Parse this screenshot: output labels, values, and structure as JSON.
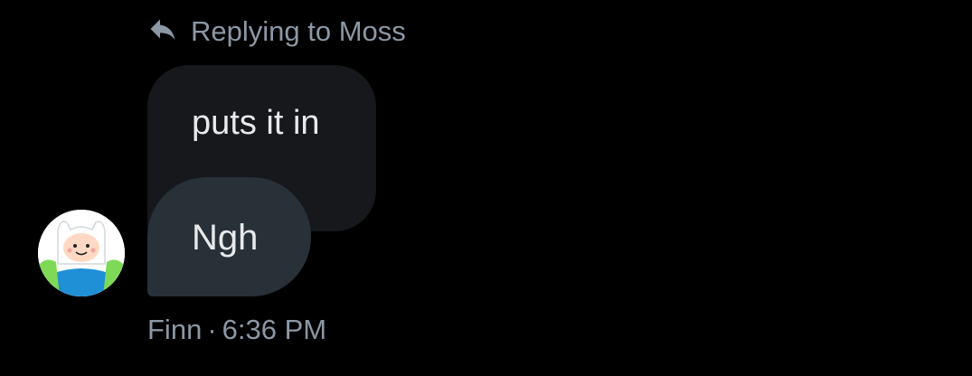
{
  "reply_header": {
    "text": "Replying to Moss",
    "icon": "reply-arrow-icon"
  },
  "quoted_message": {
    "text": "puts it in"
  },
  "message": {
    "text": "Ngh"
  },
  "sender": {
    "name": "Finn",
    "separator": "·",
    "time": "6:36 PM",
    "avatar_icon": "avatar"
  },
  "colors": {
    "background": "#000000",
    "quoted_bubble": "#16181c",
    "message_bubble": "#283038",
    "secondary_text": "#8b98a5",
    "primary_text": "#e7e9ea"
  }
}
